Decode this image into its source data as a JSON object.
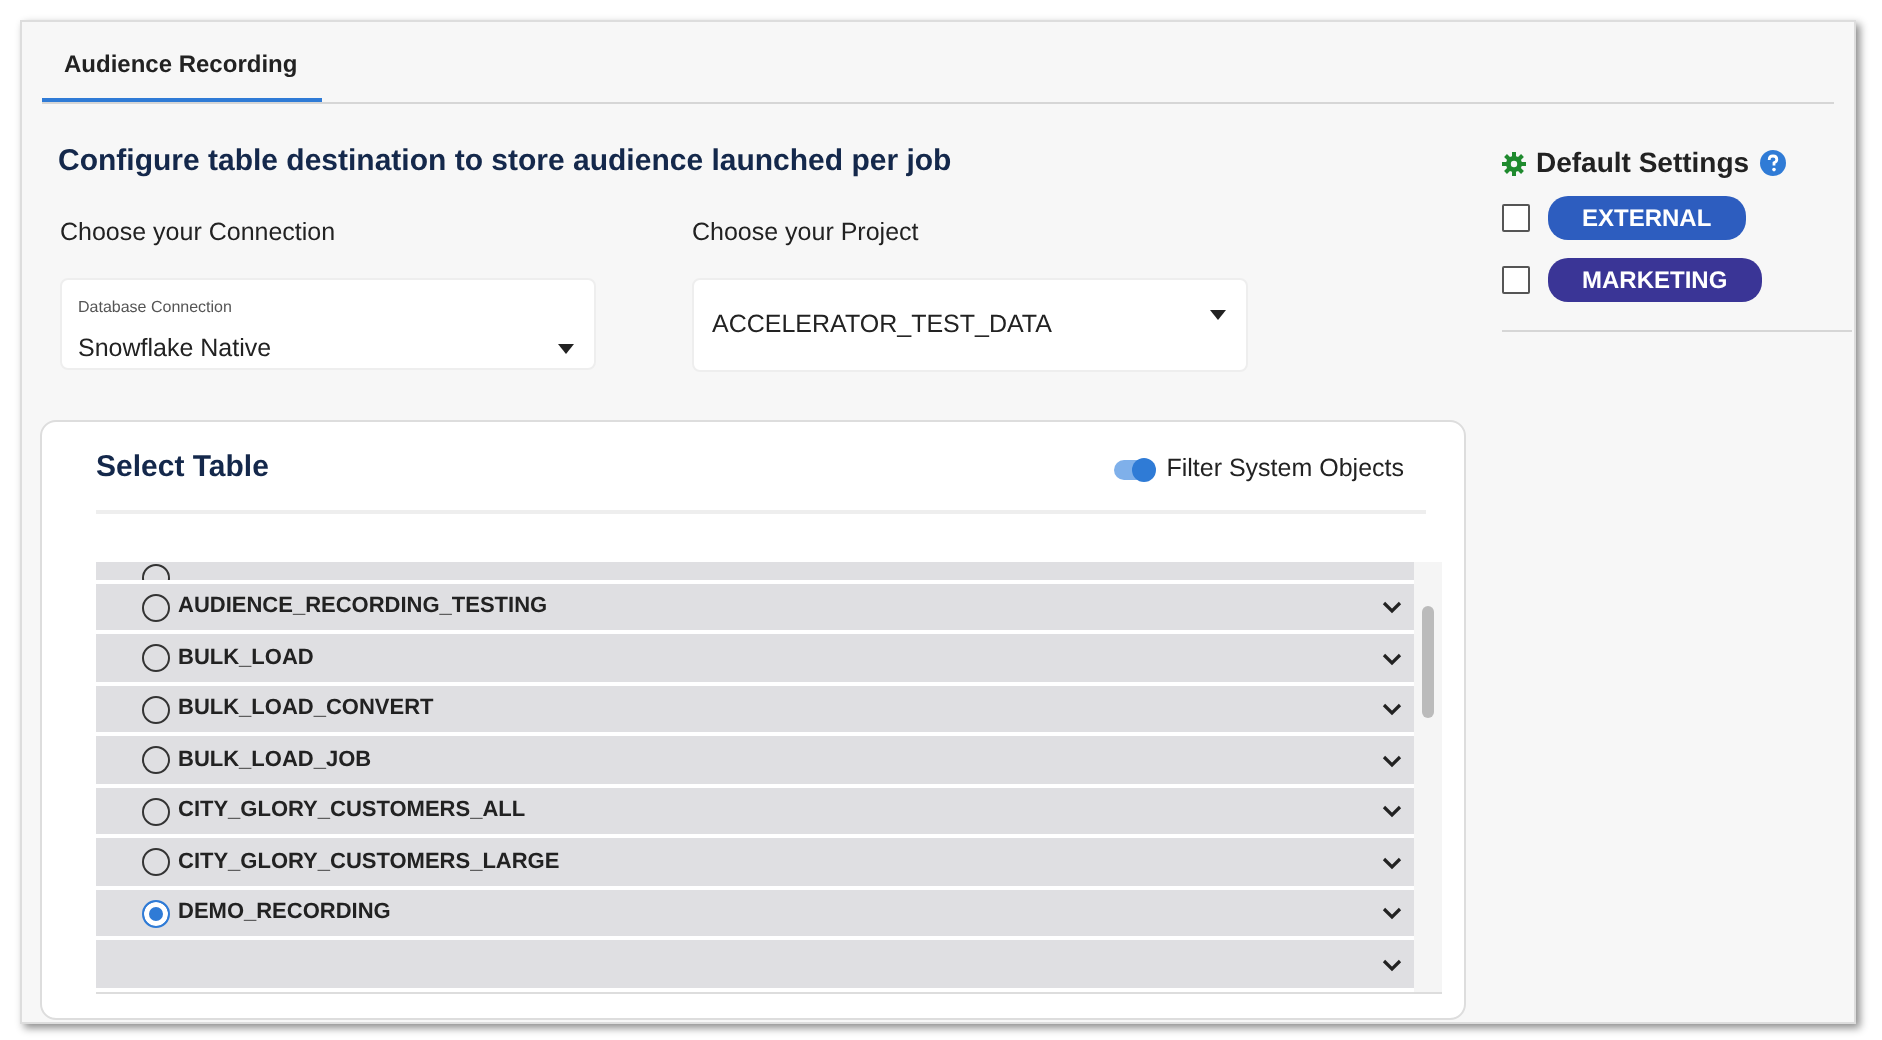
{
  "tabs": [
    {
      "label": "Audience Recording",
      "selected": true
    }
  ],
  "heading": "Configure table destination to store audience launched per job",
  "connection": {
    "label": "Choose your Connection",
    "field_label": "Database Connection",
    "value": "Snowflake Native"
  },
  "project": {
    "label": "Choose your Project",
    "value": "ACCELERATOR_TEST_DATA"
  },
  "select_table": {
    "title": "Select Table",
    "filter_toggle": {
      "label": "Filter System Objects",
      "on": true
    },
    "rows": [
      {
        "kind": "cut",
        "selected": false
      },
      {
        "label": "AUDIENCE_RECORDING_TESTING",
        "selected": false
      },
      {
        "label": "BULK_LOAD",
        "selected": false
      },
      {
        "label": "BULK_LOAD_CONVERT",
        "selected": false
      },
      {
        "label": "BULK_LOAD_JOB",
        "selected": false
      },
      {
        "label": "CITY_GLORY_CUSTOMERS_ALL",
        "selected": false
      },
      {
        "label": "CITY_GLORY_CUSTOMERS_LARGE",
        "selected": false
      },
      {
        "label": "DEMO_RECORDING",
        "selected": true
      },
      {
        "kind": "blank"
      }
    ]
  },
  "default_settings": {
    "title": "Default Settings",
    "tags": [
      {
        "label": "EXTERNAL",
        "checked": false,
        "color": "#2d5dbf"
      },
      {
        "label": "MARKETING",
        "checked": false,
        "color": "#3a3596"
      }
    ]
  }
}
